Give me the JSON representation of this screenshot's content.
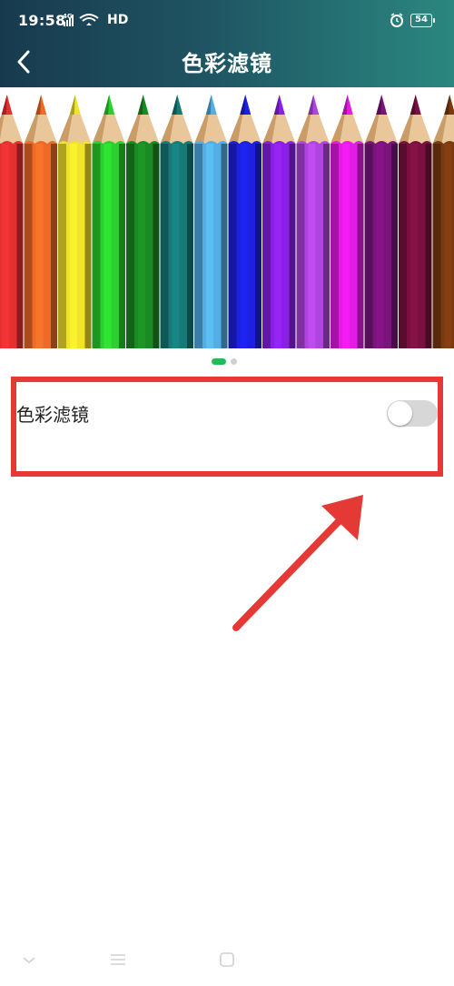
{
  "status_bar": {
    "time": "19:58",
    "network": "4G",
    "wifi_label": "HD",
    "battery": "54"
  },
  "header": {
    "title": "色彩滤镜"
  },
  "banner": {
    "pencil_colors": [
      "#e53030",
      "#ee6a26",
      "#f2e22a",
      "#2ad12e",
      "#1a8a22",
      "#167a78",
      "#53aee6",
      "#1c20e0",
      "#8a20e6",
      "#b044e0",
      "#e41ae6",
      "#7a137a",
      "#7a1040",
      "#7a3a10"
    ],
    "page_count": 2,
    "active_page": 1
  },
  "setting": {
    "label": "色彩滤镜",
    "enabled": false
  },
  "nav_bar": {
    "icons": [
      "back-icon",
      "menu-icon",
      "home-icon"
    ]
  }
}
